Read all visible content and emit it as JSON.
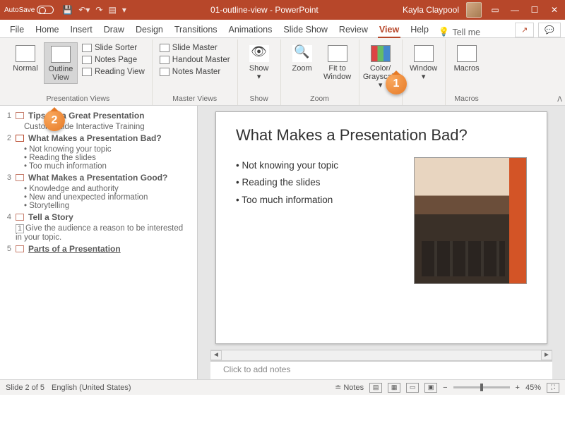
{
  "titlebar": {
    "autosave": "AutoSave",
    "doc": "01-outline-view - PowerPoint",
    "user": "Kayla Claypool"
  },
  "tabs": [
    "File",
    "Home",
    "Insert",
    "Draw",
    "Design",
    "Transitions",
    "Animations",
    "Slide Show",
    "Review",
    "View",
    "Help"
  ],
  "tellme": "Tell me",
  "share": {
    "icon1": "↗",
    "icon2": "💬"
  },
  "ribbon": {
    "pres_views": {
      "label": "Presentation Views",
      "normal": "Normal",
      "outline": "Outline\nView",
      "sorter": "Slide Sorter",
      "notes": "Notes Page",
      "reading": "Reading View"
    },
    "master_views": {
      "label": "Master Views",
      "slide": "Slide Master",
      "handout": "Handout Master",
      "notesm": "Notes Master"
    },
    "show": {
      "label": "Show",
      "btn": "Show"
    },
    "zoom": {
      "label": "Zoom",
      "zoom": "Zoom",
      "fit": "Fit to\nWindow"
    },
    "color": {
      "label": "",
      "btn": "Color/\nGrayscale"
    },
    "window": {
      "label": "",
      "btn": "Window"
    },
    "macros": {
      "label": "Macros",
      "btn": "Macros"
    }
  },
  "outline": [
    {
      "n": "1",
      "title": "Tips for a Great Presentation",
      "subs": [
        "CustomGuide Interactive Training"
      ],
      "nosub_bullet": true
    },
    {
      "n": "2",
      "title": "What Makes a Presentation Bad?",
      "sel": true,
      "subs": [
        "Not knowing your topic",
        "Reading the slides",
        "Too much information"
      ]
    },
    {
      "n": "3",
      "title": "What Makes a Presentation Good?",
      "subs": [
        "Knowledge and authority",
        "New and unexpected information",
        "Storytelling"
      ]
    },
    {
      "n": "4",
      "title": "Tell a Story",
      "boxed": "1",
      "sub_plain": "Give the audience a reason to be interested in your topic."
    },
    {
      "n": "5",
      "title": "Parts of a Presentation",
      "ul": true
    }
  ],
  "slide": {
    "title": "What Makes a Presentation Bad?",
    "bullets": [
      "Not knowing your topic",
      "Reading the slides",
      "Too much information"
    ]
  },
  "notes_placeholder": "Click to add notes",
  "status": {
    "slide": "Slide 2 of 5",
    "lang": "English (United States)",
    "notes": "Notes",
    "zoom": "45%"
  },
  "callouts": {
    "c1": "1",
    "c2": "2"
  }
}
